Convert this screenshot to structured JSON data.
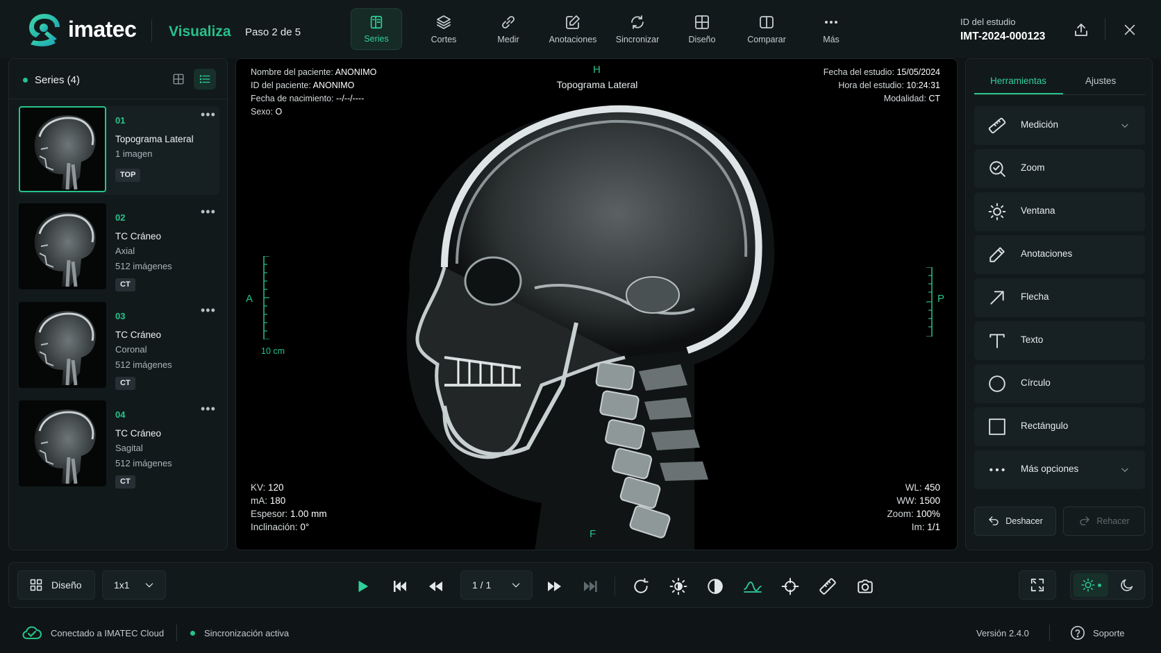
{
  "header": {
    "logo_text": "imatec",
    "mode": "Visualiza",
    "step": "Paso 2 de 5",
    "toolbar": [
      {
        "label": "Series",
        "icon": "series-icon",
        "active": true
      },
      {
        "label": "Cortes",
        "icon": "layers-icon"
      },
      {
        "label": "Medir",
        "icon": "measure-icon"
      },
      {
        "label": "Anotaciones",
        "icon": "pencil-square-icon"
      },
      {
        "label": "Sincronizar",
        "icon": "sync-icon"
      },
      {
        "label": "Diseño",
        "icon": "layout-grid-icon"
      },
      {
        "label": "Comparar",
        "icon": "compare-icon"
      },
      {
        "label": "Más",
        "icon": "more-dots-icon"
      }
    ],
    "study_label": "ID del estudio",
    "study_id": "IMT-2024-000123",
    "accent": "#27c389"
  },
  "series_panel": {
    "title": "Series (4)",
    "items": [
      {
        "num": "01",
        "name": "Topograma Lateral",
        "line2": "1 imagen",
        "line3": "",
        "tag": "TOP"
      },
      {
        "num": "02",
        "name": "TC Cráneo",
        "line2": "Axial",
        "line3": "512 imágenes",
        "tag": "CT"
      },
      {
        "num": "03",
        "name": "TC Cráneo",
        "line2": "Coronal",
        "line3": "512 imágenes",
        "tag": "CT"
      },
      {
        "num": "04",
        "name": "TC Cráneo",
        "line2": "Sagital",
        "line3": "512 imágenes",
        "tag": "CT"
      }
    ]
  },
  "viewer": {
    "top_left": [
      {
        "label": "Nombre del paciente:",
        "value": "ANONIMO"
      },
      {
        "label": "ID del paciente:",
        "value": "ANONIMO"
      },
      {
        "label": "Fecha de nacimiento:",
        "value": "--/--/----"
      },
      {
        "label": "Sexo:",
        "value": "O"
      }
    ],
    "top_right": [
      {
        "label": "Fecha del estudio:",
        "value": "15/05/2024"
      },
      {
        "label": "Hora del estudio:",
        "value": "10:24:31"
      },
      {
        "label": "Modalidad:",
        "value": "CT"
      }
    ],
    "bottom_left": [
      {
        "label": "KV:",
        "value": "120"
      },
      {
        "label": "mA:",
        "value": "180"
      },
      {
        "label": "Espesor:",
        "value": "1.00 mm"
      },
      {
        "label": "Inclinación:",
        "value": "0°"
      }
    ],
    "bottom_right": [
      {
        "label": "WL:",
        "value": "450"
      },
      {
        "label": "WW:",
        "value": "1500"
      },
      {
        "label": "Zoom:",
        "value": "100%"
      },
      {
        "label": "Im:",
        "value": "1/1"
      }
    ],
    "orientation": {
      "top": "H",
      "bottom": "F",
      "left": "A",
      "right": "P"
    },
    "image_title": "Topograma Lateral",
    "scale_label": "10 cm"
  },
  "tools_panel": {
    "tabs": [
      "Herramientas",
      "Ajustes"
    ],
    "active_tab": "Herramientas",
    "items": [
      {
        "label": "Medición",
        "icon": "ruler-icon",
        "chevron": true
      },
      {
        "label": "Zoom",
        "icon": "zoom-icon"
      },
      {
        "label": "Ventana",
        "icon": "sun-icon"
      },
      {
        "label": "Anotaciones",
        "icon": "pencil-icon"
      },
      {
        "label": "Flecha",
        "icon": "arrow-icon"
      },
      {
        "label": "Texto",
        "icon": "text-icon"
      },
      {
        "label": "Círculo",
        "icon": "circle-icon"
      },
      {
        "label": "Rectángulo",
        "icon": "rectangle-icon"
      },
      {
        "label": "Más opciones",
        "icon": "more-dots-icon",
        "chevron": true
      }
    ],
    "undo_label": "Deshacer",
    "redo_label": "Rehacer"
  },
  "bottom_bar": {
    "layout_label": "Diseño",
    "layout_value": "1x1",
    "frame_value": "1 / 1"
  },
  "status": {
    "cloud": "Conectado a IMATEC Cloud",
    "sync": "Sincronización activa",
    "version": "Versión 2.4.0",
    "support": "Soporte"
  }
}
